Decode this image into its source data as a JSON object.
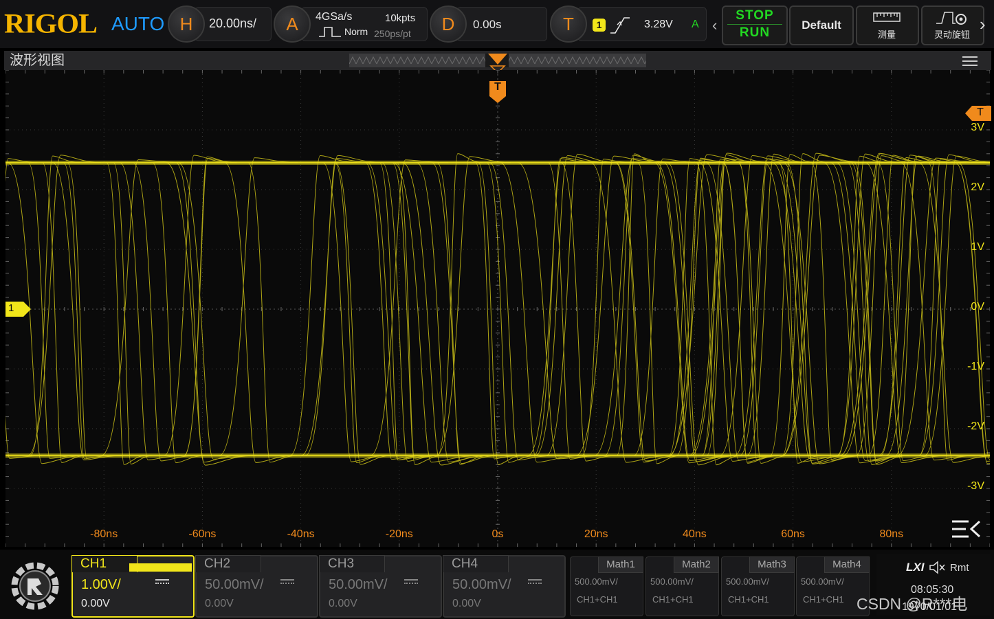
{
  "brand": {
    "logo": "RIGOL",
    "mode": "AUTO"
  },
  "horizontal": {
    "icon_letter": "H",
    "timebase": "20.00ns/"
  },
  "acquire": {
    "icon_letter": "A",
    "sample_rate": "4GSa/s",
    "memory_depth": "10kpts",
    "acq_mode": "Norm",
    "resolution": "250ps/pt"
  },
  "delay": {
    "icon_letter": "D",
    "value": "0.00s"
  },
  "trigger": {
    "icon_letter": "T",
    "source": "1",
    "level": "3.28V",
    "sweep": "A"
  },
  "controls": {
    "stop": "STOP",
    "run": "RUN",
    "default": "Default",
    "measure": "测量",
    "knob": "灵动旋钮"
  },
  "waveform_view": {
    "title": "波形视图"
  },
  "markers": {
    "trigger_position": "T",
    "trigger_level": "T",
    "channel": "1"
  },
  "y_axis_labels": [
    "3V",
    "2V",
    "1V",
    "0V",
    "-1V",
    "-2V",
    "-3V"
  ],
  "x_axis_labels": [
    "-80ns",
    "-60ns",
    "-40ns",
    "-20ns",
    "0s",
    "20ns",
    "40ns",
    "60ns",
    "80ns"
  ],
  "channels": [
    {
      "name": "CH1",
      "scale": "1.00V/",
      "offset": "0.00V",
      "coupling": "DC",
      "active": true
    },
    {
      "name": "CH2",
      "scale": "50.00mV/",
      "offset": "0.00V",
      "coupling": "DC",
      "active": false
    },
    {
      "name": "CH3",
      "scale": "50.00mV/",
      "offset": "0.00V",
      "coupling": "DC",
      "active": false
    },
    {
      "name": "CH4",
      "scale": "50.00mV/",
      "offset": "0.00V",
      "coupling": "DC",
      "active": false
    }
  ],
  "math": [
    {
      "name": "Math1",
      "scale": "500.00mV/",
      "expr": "CH1+CH1"
    },
    {
      "name": "Math2",
      "scale": "500.00mV/",
      "expr": "CH1+CH1"
    },
    {
      "name": "Math3",
      "scale": "500.00mV/",
      "expr": "CH1+CH1"
    },
    {
      "name": "Math4",
      "scale": "500.00mV/",
      "expr": "CH1+CH1"
    }
  ],
  "status": {
    "lxi": "LXI",
    "remote": "Rmt",
    "time": "08:05:30",
    "date": "1970/01/01"
  },
  "watermark": "CSDN @R***电",
  "colors": {
    "ch1": "#f2e61a",
    "accent_orange": "#f08a1c",
    "run_green": "#22d822",
    "auto_blue": "#1e9bff"
  }
}
